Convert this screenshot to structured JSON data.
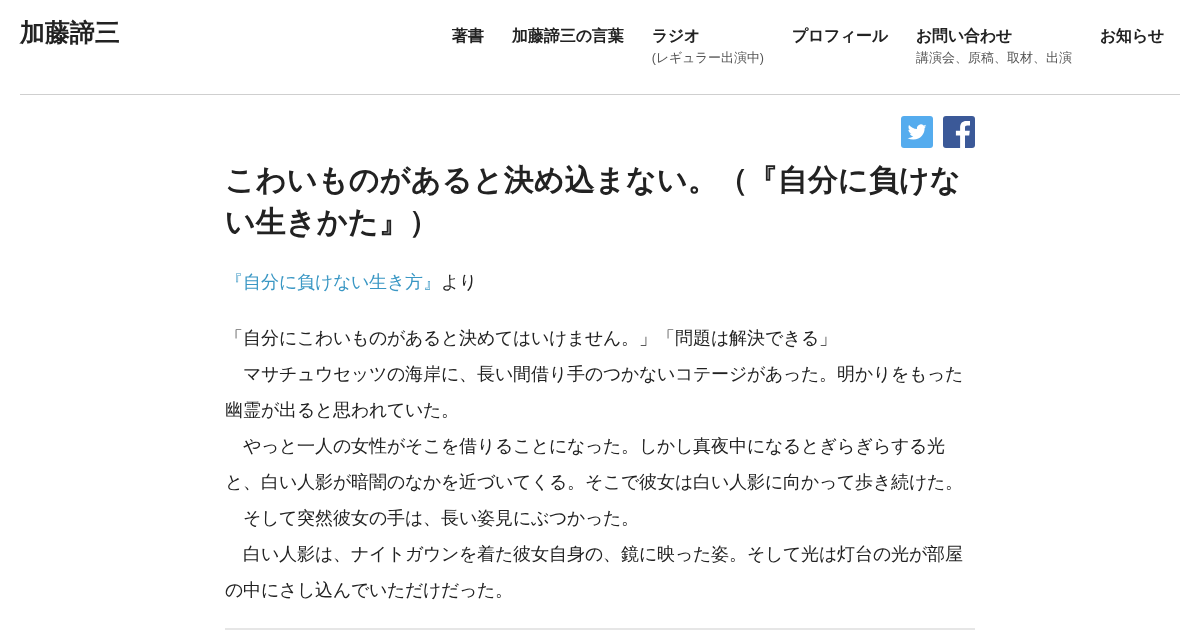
{
  "header": {
    "logo": "加藤諦三",
    "nav": [
      {
        "label": "著書"
      },
      {
        "label": "加藤諦三の言葉"
      },
      {
        "label": "ラジオ",
        "sublabel": "(レギュラー出演中)"
      },
      {
        "label": "プロフィール"
      },
      {
        "label": "お問い合わせ",
        "sublabel": "講演会、原稿、取材、出演"
      },
      {
        "label": "お知らせ"
      }
    ]
  },
  "share_buttons": [
    {
      "kind": "twitter"
    },
    {
      "kind": "facebook"
    }
  ],
  "article": {
    "title": "こわいものがあると決め込まない。（『自分に負けない生きかた』）",
    "source": {
      "link": "『自分に負けない生き方』",
      "suffix": "より"
    },
    "paragraphs": [
      "「自分にこわいものがあると決めてはいけません。」「問題は解決できる」",
      "　マサチュウセッツの海岸に、長い間借り手のつかないコテージがあった。明かりをもった幽霊が出ると思われていた。",
      "　やっと一人の女性がそこを借りることになった。しかし真夜中になるとぎらぎらする光と、白い人影が暗闇のなかを近づいてくる。そこで彼女は白い人影に向かって歩き続けた。",
      "　そして突然彼女の手は、長い姿見にぶつかった。",
      "　白い人影は、ナイトガウンを着た彼女自身の、鏡に映った姿。そして光は灯台の光が部屋の中にさし込んでいただけだった。"
    ]
  }
}
